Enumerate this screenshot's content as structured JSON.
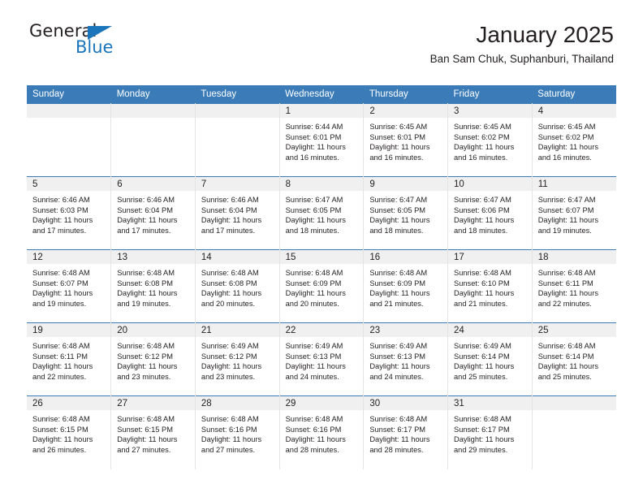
{
  "brand": {
    "name_primary": "General",
    "name_secondary": "Blue",
    "triangle_color": "#1b75bb",
    "primary_color": "#231f20"
  },
  "header": {
    "title": "January 2025",
    "subtitle": "Ban Sam Chuk, Suphanburi, Thailand"
  },
  "theme": {
    "header_bg": "#3b7cb8",
    "header_text": "#ffffff",
    "daynum_bg": "#f0f0f0",
    "cell_bg": "#ffffff",
    "text": "#231f20"
  },
  "calendar": {
    "weekday_headers": [
      "Sunday",
      "Monday",
      "Tuesday",
      "Wednesday",
      "Thursday",
      "Friday",
      "Saturday"
    ],
    "leading_blanks": 3,
    "weeks": [
      [
        {
          "day": "",
          "lines": []
        },
        {
          "day": "",
          "lines": []
        },
        {
          "day": "",
          "lines": []
        },
        {
          "day": "1",
          "lines": [
            "Sunrise: 6:44 AM",
            "Sunset: 6:01 PM",
            "Daylight: 11 hours",
            "and 16 minutes."
          ]
        },
        {
          "day": "2",
          "lines": [
            "Sunrise: 6:45 AM",
            "Sunset: 6:01 PM",
            "Daylight: 11 hours",
            "and 16 minutes."
          ]
        },
        {
          "day": "3",
          "lines": [
            "Sunrise: 6:45 AM",
            "Sunset: 6:02 PM",
            "Daylight: 11 hours",
            "and 16 minutes."
          ]
        },
        {
          "day": "4",
          "lines": [
            "Sunrise: 6:45 AM",
            "Sunset: 6:02 PM",
            "Daylight: 11 hours",
            "and 16 minutes."
          ]
        }
      ],
      [
        {
          "day": "5",
          "lines": [
            "Sunrise: 6:46 AM",
            "Sunset: 6:03 PM",
            "Daylight: 11 hours",
            "and 17 minutes."
          ]
        },
        {
          "day": "6",
          "lines": [
            "Sunrise: 6:46 AM",
            "Sunset: 6:04 PM",
            "Daylight: 11 hours",
            "and 17 minutes."
          ]
        },
        {
          "day": "7",
          "lines": [
            "Sunrise: 6:46 AM",
            "Sunset: 6:04 PM",
            "Daylight: 11 hours",
            "and 17 minutes."
          ]
        },
        {
          "day": "8",
          "lines": [
            "Sunrise: 6:47 AM",
            "Sunset: 6:05 PM",
            "Daylight: 11 hours",
            "and 18 minutes."
          ]
        },
        {
          "day": "9",
          "lines": [
            "Sunrise: 6:47 AM",
            "Sunset: 6:05 PM",
            "Daylight: 11 hours",
            "and 18 minutes."
          ]
        },
        {
          "day": "10",
          "lines": [
            "Sunrise: 6:47 AM",
            "Sunset: 6:06 PM",
            "Daylight: 11 hours",
            "and 18 minutes."
          ]
        },
        {
          "day": "11",
          "lines": [
            "Sunrise: 6:47 AM",
            "Sunset: 6:07 PM",
            "Daylight: 11 hours",
            "and 19 minutes."
          ]
        }
      ],
      [
        {
          "day": "12",
          "lines": [
            "Sunrise: 6:48 AM",
            "Sunset: 6:07 PM",
            "Daylight: 11 hours",
            "and 19 minutes."
          ]
        },
        {
          "day": "13",
          "lines": [
            "Sunrise: 6:48 AM",
            "Sunset: 6:08 PM",
            "Daylight: 11 hours",
            "and 19 minutes."
          ]
        },
        {
          "day": "14",
          "lines": [
            "Sunrise: 6:48 AM",
            "Sunset: 6:08 PM",
            "Daylight: 11 hours",
            "and 20 minutes."
          ]
        },
        {
          "day": "15",
          "lines": [
            "Sunrise: 6:48 AM",
            "Sunset: 6:09 PM",
            "Daylight: 11 hours",
            "and 20 minutes."
          ]
        },
        {
          "day": "16",
          "lines": [
            "Sunrise: 6:48 AM",
            "Sunset: 6:09 PM",
            "Daylight: 11 hours",
            "and 21 minutes."
          ]
        },
        {
          "day": "17",
          "lines": [
            "Sunrise: 6:48 AM",
            "Sunset: 6:10 PM",
            "Daylight: 11 hours",
            "and 21 minutes."
          ]
        },
        {
          "day": "18",
          "lines": [
            "Sunrise: 6:48 AM",
            "Sunset: 6:11 PM",
            "Daylight: 11 hours",
            "and 22 minutes."
          ]
        }
      ],
      [
        {
          "day": "19",
          "lines": [
            "Sunrise: 6:48 AM",
            "Sunset: 6:11 PM",
            "Daylight: 11 hours",
            "and 22 minutes."
          ]
        },
        {
          "day": "20",
          "lines": [
            "Sunrise: 6:48 AM",
            "Sunset: 6:12 PM",
            "Daylight: 11 hours",
            "and 23 minutes."
          ]
        },
        {
          "day": "21",
          "lines": [
            "Sunrise: 6:49 AM",
            "Sunset: 6:12 PM",
            "Daylight: 11 hours",
            "and 23 minutes."
          ]
        },
        {
          "day": "22",
          "lines": [
            "Sunrise: 6:49 AM",
            "Sunset: 6:13 PM",
            "Daylight: 11 hours",
            "and 24 minutes."
          ]
        },
        {
          "day": "23",
          "lines": [
            "Sunrise: 6:49 AM",
            "Sunset: 6:13 PM",
            "Daylight: 11 hours",
            "and 24 minutes."
          ]
        },
        {
          "day": "24",
          "lines": [
            "Sunrise: 6:49 AM",
            "Sunset: 6:14 PM",
            "Daylight: 11 hours",
            "and 25 minutes."
          ]
        },
        {
          "day": "25",
          "lines": [
            "Sunrise: 6:48 AM",
            "Sunset: 6:14 PM",
            "Daylight: 11 hours",
            "and 25 minutes."
          ]
        }
      ],
      [
        {
          "day": "26",
          "lines": [
            "Sunrise: 6:48 AM",
            "Sunset: 6:15 PM",
            "Daylight: 11 hours",
            "and 26 minutes."
          ]
        },
        {
          "day": "27",
          "lines": [
            "Sunrise: 6:48 AM",
            "Sunset: 6:15 PM",
            "Daylight: 11 hours",
            "and 27 minutes."
          ]
        },
        {
          "day": "28",
          "lines": [
            "Sunrise: 6:48 AM",
            "Sunset: 6:16 PM",
            "Daylight: 11 hours",
            "and 27 minutes."
          ]
        },
        {
          "day": "29",
          "lines": [
            "Sunrise: 6:48 AM",
            "Sunset: 6:16 PM",
            "Daylight: 11 hours",
            "and 28 minutes."
          ]
        },
        {
          "day": "30",
          "lines": [
            "Sunrise: 6:48 AM",
            "Sunset: 6:17 PM",
            "Daylight: 11 hours",
            "and 28 minutes."
          ]
        },
        {
          "day": "31",
          "lines": [
            "Sunrise: 6:48 AM",
            "Sunset: 6:17 PM",
            "Daylight: 11 hours",
            "and 29 minutes."
          ]
        },
        {
          "day": "",
          "lines": []
        }
      ]
    ]
  }
}
